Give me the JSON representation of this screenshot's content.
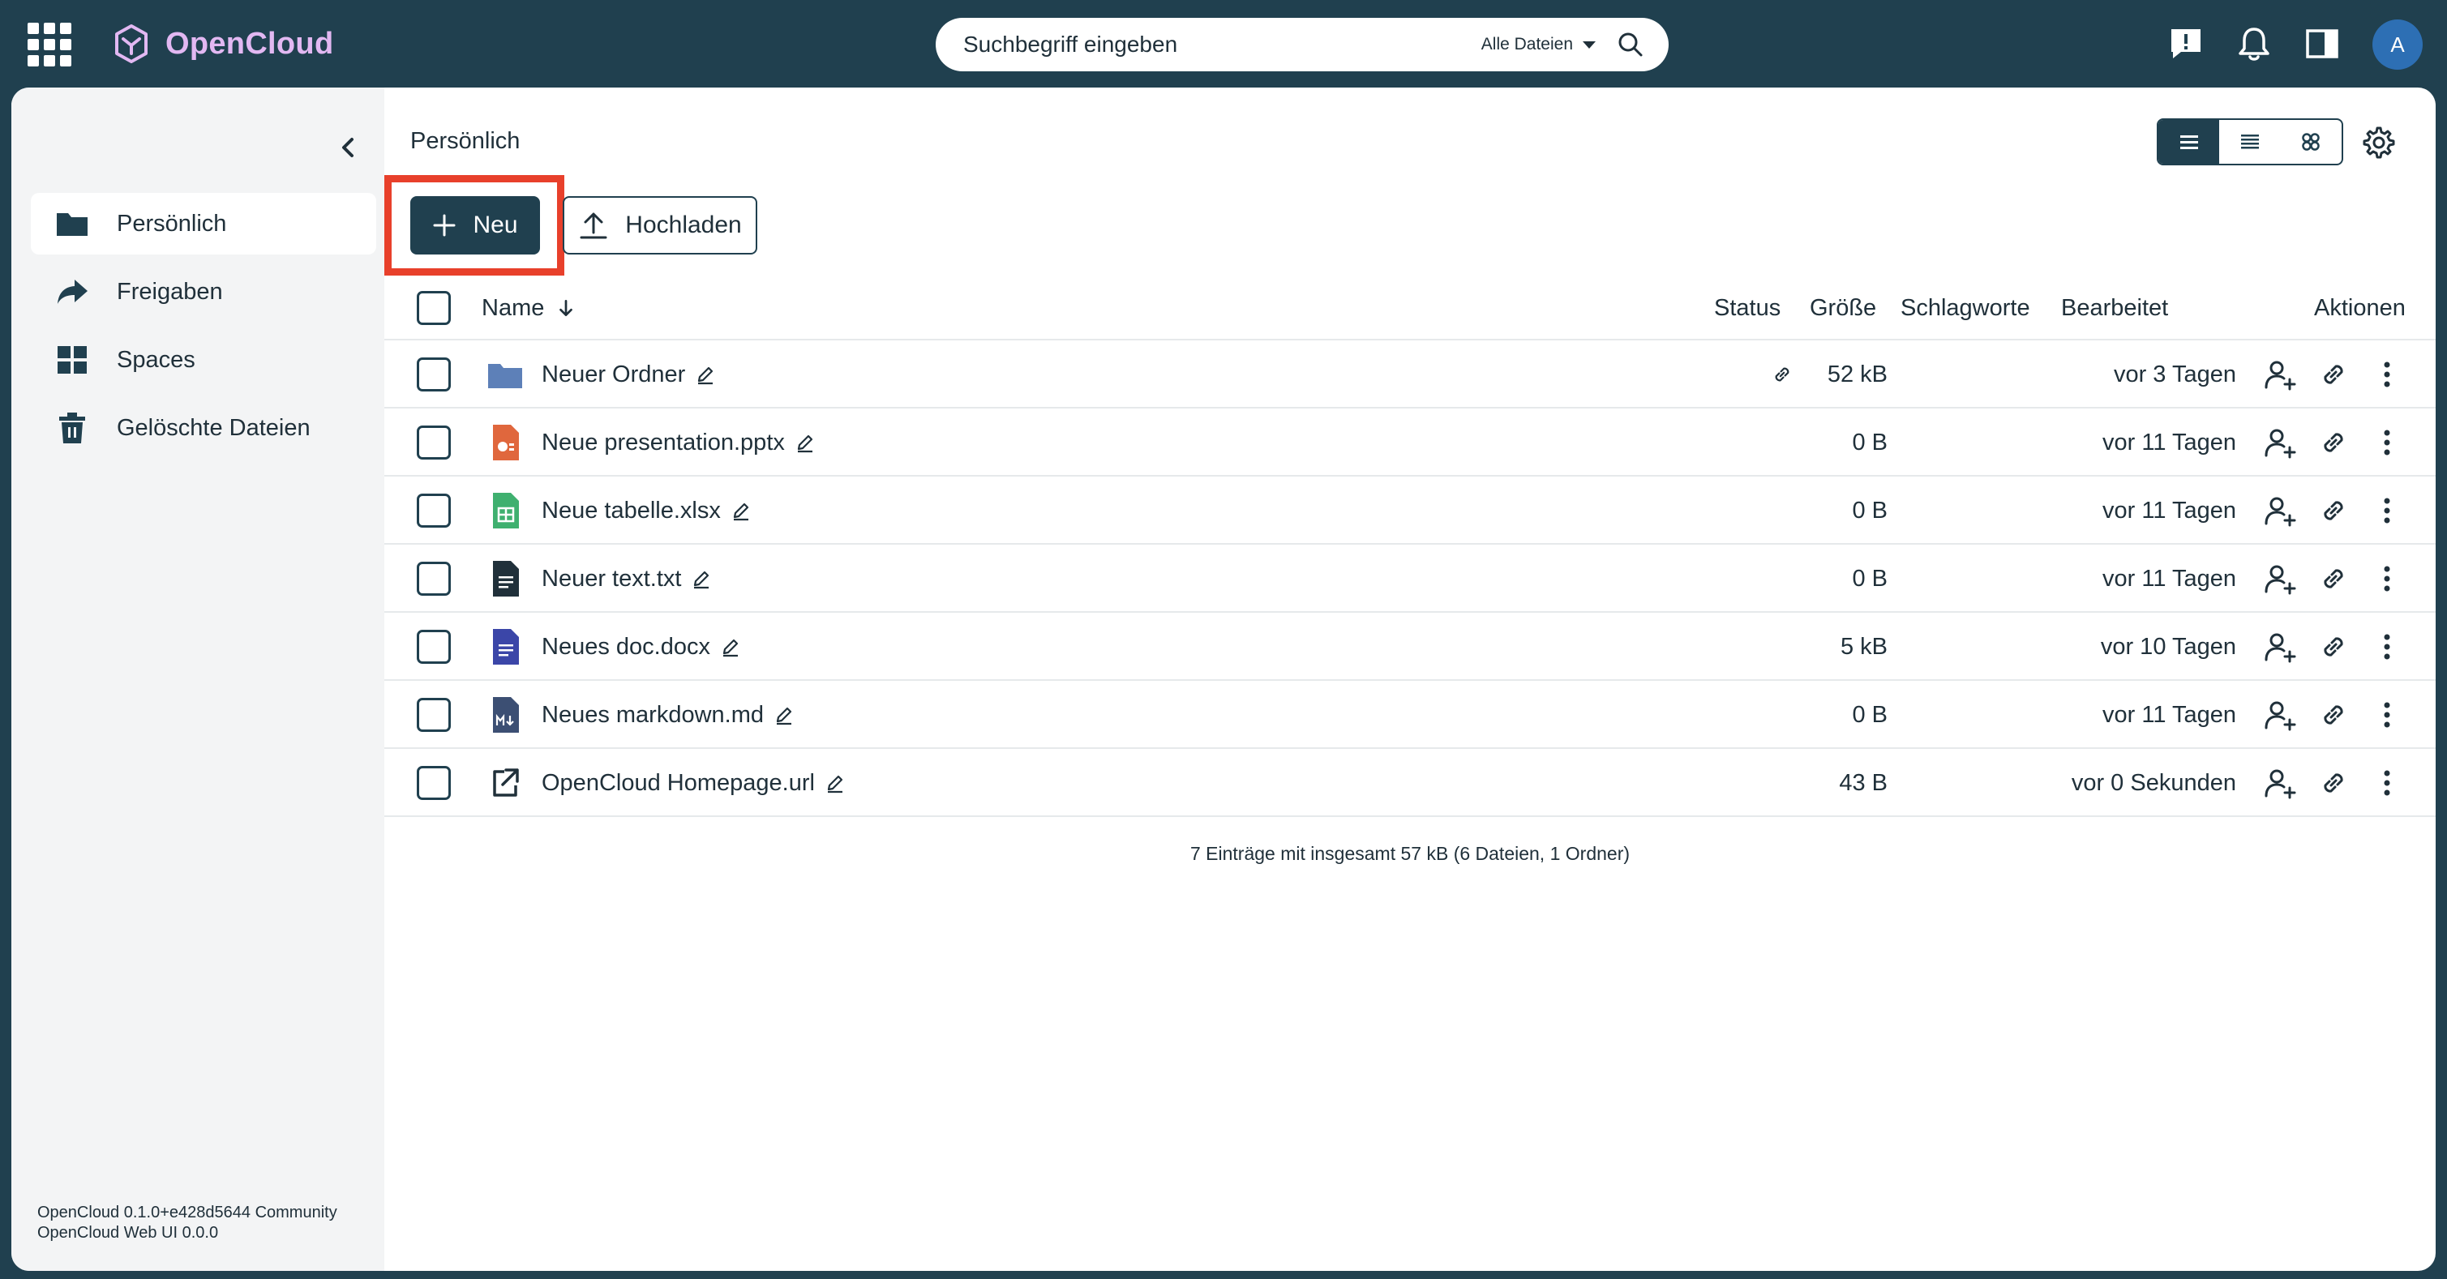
{
  "brand": {
    "name": "OpenCloud"
  },
  "search": {
    "placeholder": "Suchbegriff eingeben",
    "scope": "Alle Dateien"
  },
  "user": {
    "initial": "A"
  },
  "sidebar": {
    "items": [
      {
        "label": "Persönlich",
        "icon": "folder-icon",
        "active": true
      },
      {
        "label": "Freigaben",
        "icon": "share-icon",
        "active": false
      },
      {
        "label": "Spaces",
        "icon": "spaces-icon",
        "active": false
      },
      {
        "label": "Gelöschte Dateien",
        "icon": "trash-icon",
        "active": false
      }
    ],
    "version_line1": "OpenCloud 0.1.0+e428d5644 Community",
    "version_line2": "OpenCloud Web UI 0.0.0"
  },
  "main": {
    "breadcrumb": "Persönlich",
    "new_label": "Neu",
    "upload_label": "Hochladen",
    "view_mode": "list"
  },
  "table": {
    "columns": {
      "name": "Name",
      "status": "Status",
      "size": "Größe",
      "tags": "Schlagworte",
      "modified": "Bearbeitet",
      "actions": "Aktionen"
    },
    "rows": [
      {
        "name": "Neuer Ordner",
        "type": "folder",
        "shared_link": true,
        "size": "52 kB",
        "modified": "vor 3 Tagen"
      },
      {
        "name": "Neue presentation.pptx",
        "type": "pptx",
        "shared_link": false,
        "size": "0 B",
        "modified": "vor 11 Tagen"
      },
      {
        "name": "Neue tabelle.xlsx",
        "type": "xlsx",
        "shared_link": false,
        "size": "0 B",
        "modified": "vor 11 Tagen"
      },
      {
        "name": "Neuer text.txt",
        "type": "txt",
        "shared_link": false,
        "size": "0 B",
        "modified": "vor 11 Tagen"
      },
      {
        "name": "Neues doc.docx",
        "type": "docx",
        "shared_link": false,
        "size": "5 kB",
        "modified": "vor 10 Tagen"
      },
      {
        "name": "Neues markdown.md",
        "type": "md",
        "shared_link": false,
        "size": "0 B",
        "modified": "vor 11 Tagen"
      },
      {
        "name": "OpenCloud Homepage.url",
        "type": "url",
        "shared_link": false,
        "size": "43 B",
        "modified": "vor 0 Sekunden"
      }
    ],
    "summary": "7 Einträge mit insgesamt 57 kB (6 Dateien, 1 Ordner)"
  },
  "colors": {
    "topbar": "#20404f",
    "brand_text": "#e2b8f2",
    "highlight": "#e8402b",
    "folder": "#5d80b8",
    "pptx": "#e0673d",
    "xlsx": "#3fb06f",
    "txt": "#20303a",
    "docx": "#3b46a8",
    "md": "#3c4f73"
  }
}
